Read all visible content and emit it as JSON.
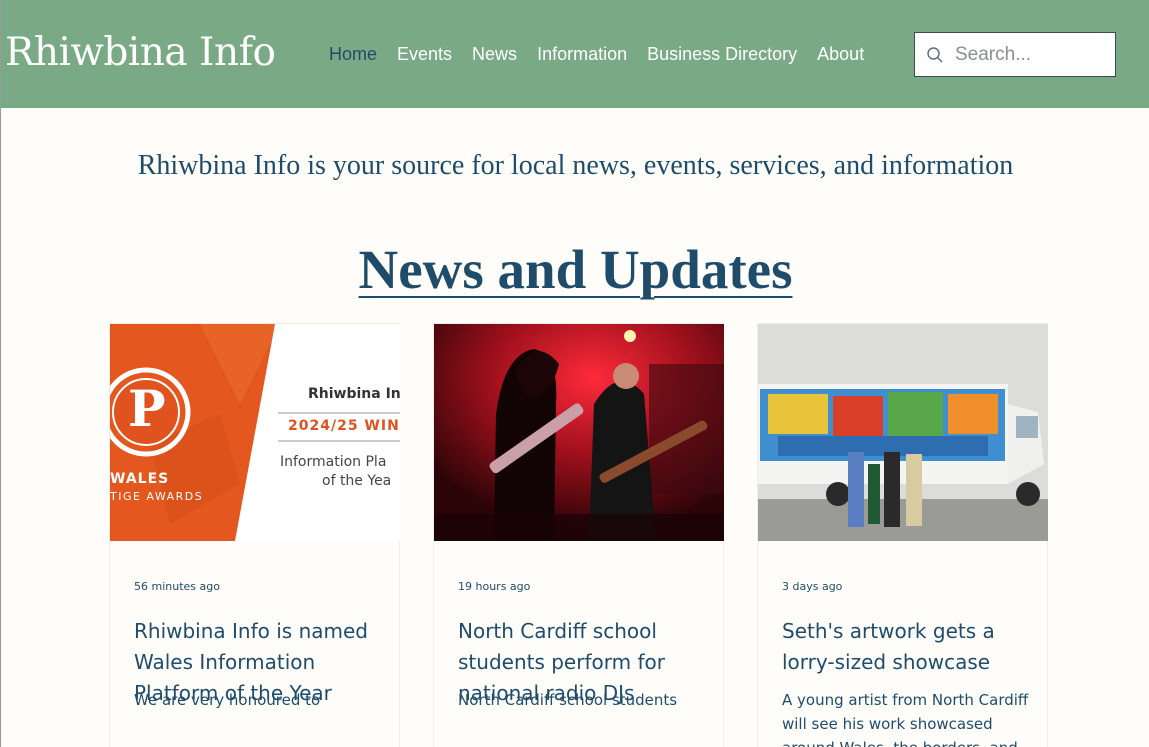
{
  "header": {
    "logo": "Rhiwbina Info",
    "nav": [
      {
        "label": "Home",
        "active": true
      },
      {
        "label": "Events",
        "active": false
      },
      {
        "label": "News",
        "active": false
      },
      {
        "label": "Information",
        "active": false
      },
      {
        "label": "Business Directory",
        "active": false
      },
      {
        "label": "About",
        "active": false
      }
    ],
    "search": {
      "placeholder": "Search...",
      "value": "",
      "icon": "search-icon"
    }
  },
  "tagline": "Rhiwbina Info is your source for local news, events, services, and information",
  "section_title": "News and Updates",
  "posts": [
    {
      "image": {
        "brand_line1": "Rhiwbina In",
        "brand_line2": "2024/25 WIN",
        "brand_line3": "Information Pla",
        "brand_line4": "of the Yea",
        "logo_letter": "P",
        "logo_line1": "WALES",
        "logo_line2": "TIGE AWARDS"
      },
      "time": "56 minutes ago",
      "title": "Rhiwbina Info is named Wales Information Platform of the Year",
      "excerpt": "We are very honoured to"
    },
    {
      "image": {},
      "time": "19 hours ago",
      "title": "North Cardiff school students perform for national radio DJs",
      "excerpt": "North Cardiff school students"
    },
    {
      "image": {},
      "time": "3 days ago",
      "title": "Seth's artwork gets a lorry-sized showcase",
      "excerpt": "A young artist from North Cardiff will see his work showcased around Wales, the borders, and"
    }
  ],
  "colors": {
    "header_bg": "#7aaa85",
    "primary_text": "#1f4c6b",
    "page_bg": "#fefdf9",
    "accent_orange": "#e0531e"
  }
}
